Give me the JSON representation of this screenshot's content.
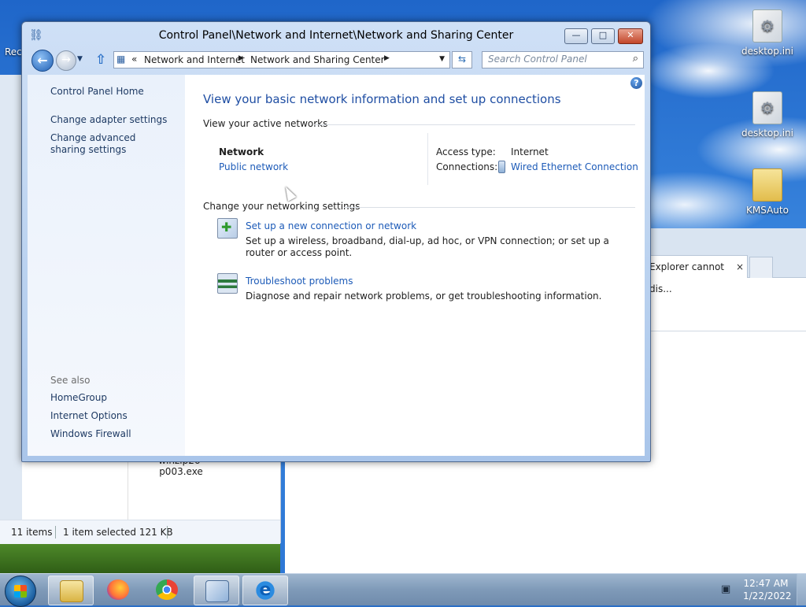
{
  "desktop": {
    "icons": [
      {
        "label": "desktop.ini",
        "icon": "ini-file-icon"
      },
      {
        "label": "desktop.ini",
        "icon": "ini-file-icon"
      },
      {
        "label": "KMSAuto",
        "icon": "folder-icon"
      }
    ],
    "partial_left_label": "Rec"
  },
  "bg_explorer": {
    "file_label": "winzip26-p003.exe",
    "status_items": "11 items",
    "status_selected": "1 item selected  121 KB"
  },
  "bg_browser": {
    "tab_label": "Explorer cannot dis...",
    "tab_close": "×"
  },
  "window": {
    "title": "Control Panel\\Network and Internet\\Network and Sharing Center",
    "buttons": {
      "minimize": "—",
      "maximize": "□",
      "close": "✕"
    },
    "address": {
      "prefix": "«",
      "crumbs": [
        "Network and Internet",
        "Network and Sharing Center"
      ]
    },
    "search": {
      "placeholder": "Search Control Panel"
    }
  },
  "left_pane": {
    "home": "Control Panel Home",
    "links": [
      "Change adapter settings",
      "Change advanced sharing settings"
    ],
    "see_also_label": "See also",
    "see_also": [
      "HomeGroup",
      "Internet Options",
      "Windows Firewall"
    ]
  },
  "main": {
    "heading": "View your basic network information and set up connections",
    "active_networks_label": "View your active networks",
    "network": {
      "name": "Network",
      "type_link": "Public network",
      "access_type_label": "Access type:",
      "access_type_value": "Internet",
      "connections_label": "Connections:",
      "connections_value": "Wired Ethernet Connection"
    },
    "change_settings_label": "Change your networking settings",
    "tasks": [
      {
        "title": "Set up a new connection or network",
        "description": "Set up a wireless, broadband, dial-up, ad hoc, or VPN connection; or set up a router or access point.",
        "icon": "new-connection-icon"
      },
      {
        "title": "Troubleshoot problems",
        "description": "Diagnose and repair network problems, or get troubleshooting information.",
        "icon": "troubleshoot-icon"
      }
    ]
  },
  "taskbar": {
    "apps": [
      "File Explorer",
      "Firefox",
      "Chrome",
      "Control Panel",
      "Internet Explorer"
    ],
    "clock_time": "12:47 AM",
    "clock_date": "1/22/2022"
  }
}
